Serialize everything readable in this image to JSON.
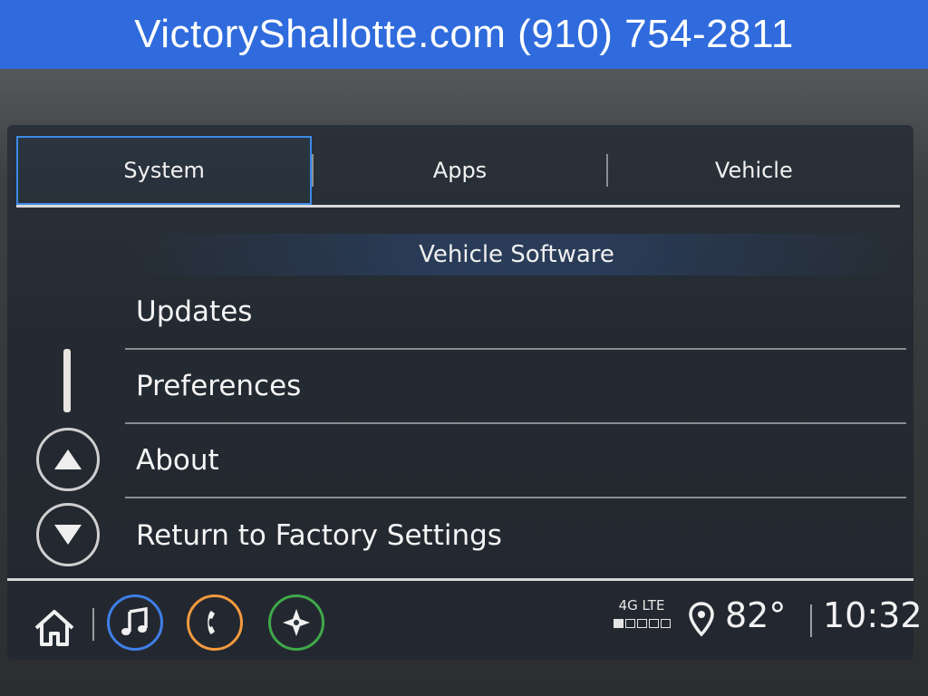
{
  "banner": {
    "text": "VictoryShallotte.com (910) 754-2811"
  },
  "tabs": [
    {
      "label": "System",
      "active": true
    },
    {
      "label": "Apps",
      "active": false
    },
    {
      "label": "Vehicle",
      "active": false
    }
  ],
  "section": {
    "title": "Vehicle Software"
  },
  "menu": {
    "items": [
      {
        "label": "Updates"
      },
      {
        "label": "Preferences"
      },
      {
        "label": "About"
      },
      {
        "label": "Return to Factory Settings"
      }
    ]
  },
  "status": {
    "network": "4G LTE",
    "signal_level": 0.2,
    "temperature": "82°",
    "time": "10:32"
  },
  "icons": {
    "home": "home-icon",
    "audio": "music-note-icon",
    "phone": "phone-icon",
    "nav": "compass-icon",
    "location": "location-pin-icon",
    "up": "arrow-up-icon",
    "down": "arrow-down-icon"
  },
  "colors": {
    "banner": "#2f6bdc",
    "tab_active_border": "#3c8be6",
    "audio_ring": "#3f7fe8",
    "phone_ring": "#f39a3e",
    "nav_ring": "#3fa84a"
  }
}
